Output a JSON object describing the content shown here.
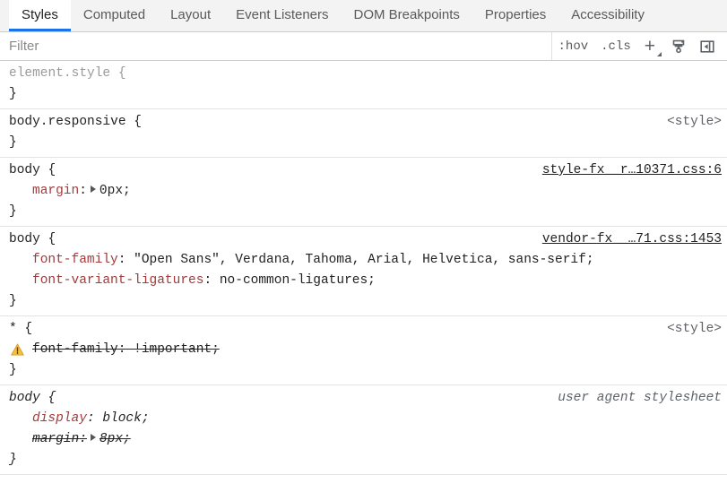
{
  "tabs": [
    {
      "label": "Styles",
      "active": true
    },
    {
      "label": "Computed",
      "active": false
    },
    {
      "label": "Layout",
      "active": false
    },
    {
      "label": "Event Listeners",
      "active": false
    },
    {
      "label": "DOM Breakpoints",
      "active": false
    },
    {
      "label": "Properties",
      "active": false
    },
    {
      "label": "Accessibility",
      "active": false
    }
  ],
  "toolbar": {
    "filter_placeholder": "Filter",
    "filter_value": "",
    "hov_label": ":hov",
    "cls_label": ".cls",
    "new_rule_label": "+",
    "element_state_icon": "paintbrush-icon",
    "sidebar_toggle_icon": "collapse-sidebar-icon"
  },
  "colors": {
    "accent": "#1a73e8",
    "property": "#a33a3a",
    "selector": "#222222",
    "origin": "#5f6368",
    "warning": "#e8a33d",
    "separator": "#e3e3e3"
  },
  "rules": [
    {
      "selector": "element.style {",
      "selector_style": "dim",
      "origin": "",
      "origin_style": "none",
      "close": "}",
      "declarations": []
    },
    {
      "selector": "body.responsive {",
      "selector_style": "normal",
      "origin": "<style>",
      "origin_style": "plain",
      "close": "}",
      "declarations": []
    },
    {
      "selector": "body {",
      "selector_style": "normal",
      "origin": "style-fx__r…10371.css:6",
      "origin_style": "link",
      "close": "}",
      "declarations": [
        {
          "name": "margin",
          "value": "0px",
          "expandable": true,
          "strike": false,
          "warning": false,
          "italic": false
        }
      ]
    },
    {
      "selector": "body {",
      "selector_style": "normal",
      "origin": "vendor-fx__…71.css:1453",
      "origin_style": "link",
      "close": "}",
      "declarations": [
        {
          "name": "font-family",
          "value": "\"Open Sans\", Verdana, Tahoma, Arial, Helvetica, sans-serif",
          "expandable": false,
          "strike": false,
          "warning": false,
          "italic": false
        },
        {
          "name": "font-variant-ligatures",
          "value": "no-common-ligatures",
          "expandable": false,
          "strike": false,
          "warning": false,
          "italic": false
        }
      ]
    },
    {
      "selector": "* {",
      "selector_style": "normal",
      "origin": "<style>",
      "origin_style": "plain",
      "close": "}",
      "declarations": [
        {
          "name": "font-family",
          "value": " !important",
          "expandable": false,
          "strike": true,
          "warning": true,
          "italic": false
        }
      ]
    },
    {
      "selector": "body {",
      "selector_style": "ua",
      "origin": "user agent stylesheet",
      "origin_style": "ua",
      "close": "}",
      "declarations": [
        {
          "name": "display",
          "value": "block",
          "expandable": false,
          "strike": false,
          "warning": false,
          "italic": true
        },
        {
          "name": "margin",
          "value": "8px",
          "expandable": true,
          "strike": true,
          "warning": false,
          "italic": true
        }
      ]
    }
  ]
}
